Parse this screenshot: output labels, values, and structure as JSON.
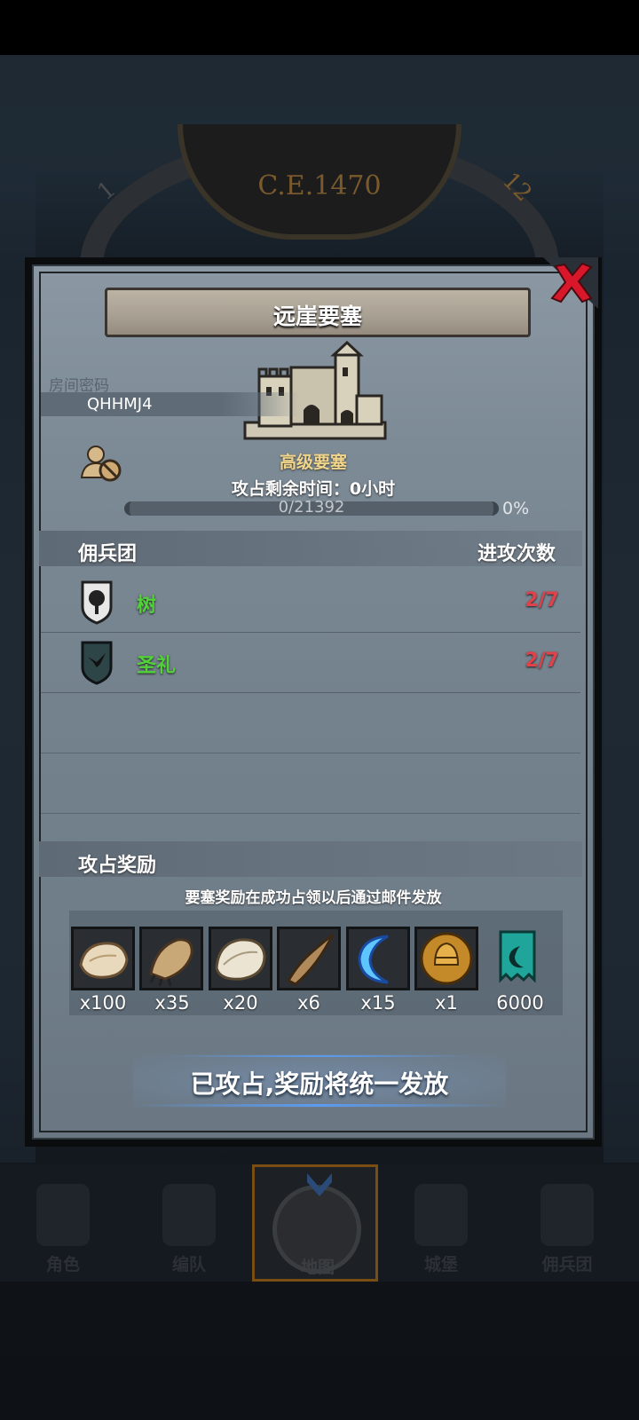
{
  "calendar": {
    "year": "C.E.1470",
    "left_number": "1",
    "right_number": "12"
  },
  "dialog": {
    "title": "远崖要塞",
    "room_password_label": "房间密码",
    "room_password": "QHHMJ4",
    "fortress_level": "高级要塞",
    "remaining_time": "攻占剩余时间：0小时",
    "progress": {
      "text": "0/21392",
      "current": 0,
      "total": 21392,
      "percent_text": "0%"
    },
    "mercenary_header": "佣兵团",
    "attack_count_header": "进攻次数",
    "mercenaries": [
      {
        "name": "树",
        "count": "2/7",
        "emblem": "tree-shield-icon"
      },
      {
        "name": "圣礼",
        "count": "2/7",
        "emblem": "bird-shield-icon"
      }
    ],
    "reward_header": "攻占奖励",
    "reward_note": "要塞奖励在成功占领以后通过邮件发放",
    "rewards": [
      {
        "icon": "fur-pelt-icon",
        "qty": "x100"
      },
      {
        "icon": "claw-icon",
        "qty": "x35"
      },
      {
        "icon": "white-hide-icon",
        "qty": "x20"
      },
      {
        "icon": "horn-icon",
        "qty": "x6"
      },
      {
        "icon": "blue-crescent-icon",
        "qty": "x15"
      },
      {
        "icon": "gold-helmet-icon",
        "qty": "x1"
      },
      {
        "icon": "guild-banner-icon",
        "qty": "6000"
      }
    ],
    "status_button": "已攻占,奖励将统一发放"
  },
  "nav": {
    "items": [
      {
        "label": "角色",
        "icon": "character-icon"
      },
      {
        "label": "编队",
        "icon": "formation-icon"
      },
      {
        "label": "地图",
        "icon": "map-icon",
        "active": true
      },
      {
        "label": "城堡",
        "icon": "castle-icon"
      },
      {
        "label": "佣兵团",
        "icon": "mercenary-icon"
      }
    ]
  },
  "colors": {
    "mercenary_name": "#52d239",
    "attack_count": "#e0424c",
    "fortress_level": "#f0d58a",
    "close_x": "#d8182a",
    "status_glow": "#5b9cf0"
  }
}
